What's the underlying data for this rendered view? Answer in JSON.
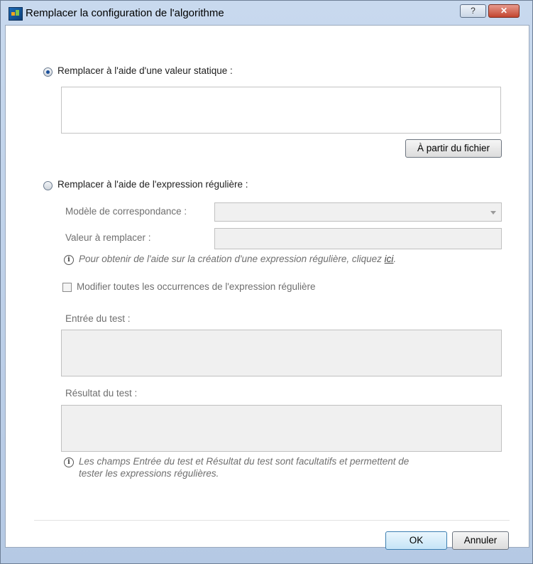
{
  "window": {
    "title": "Remplacer la configuration de l'algorithme",
    "help_glyph": "?",
    "close_glyph": "✕"
  },
  "static_option": {
    "label": "Remplacer à l'aide d'une valeur statique :",
    "selected": true,
    "value": ""
  },
  "from_file_button": "À partir du fichier",
  "regex_option": {
    "label": "Remplacer à l'aide de l'expression régulière :",
    "selected": false,
    "match_label": "Modèle de correspondance :",
    "match_value": "",
    "replace_label": "Valeur à remplacer :",
    "replace_value": "",
    "help_text": "Pour obtenir de l'aide sur la création d'une expression régulière, cliquez",
    "help_link": "ici",
    "help_end": ".",
    "modify_all_label": "Modifier toutes les occurrences de l'expression régulière",
    "modify_all_checked": false,
    "test_input_label": "Entrée du test :",
    "test_input_value": "",
    "test_result_label": "Résultat du test :",
    "test_result_value": "",
    "note_line1": "Les champs Entrée du test et Résultat du test sont facultatifs et permettent de",
    "note_line2": "tester les expressions régulières."
  },
  "footer": {
    "ok_label": "OK",
    "cancel_label": "Annuler"
  },
  "icons": {
    "info": "info-icon",
    "dropdown": "chevron-down-icon",
    "app": "app-icon"
  },
  "colors": {
    "titlebar": "#c8d9ee",
    "close_button": "#c3452f",
    "disabled_field": "#f0f0f0",
    "radio_dot": "#1a4f9a"
  }
}
